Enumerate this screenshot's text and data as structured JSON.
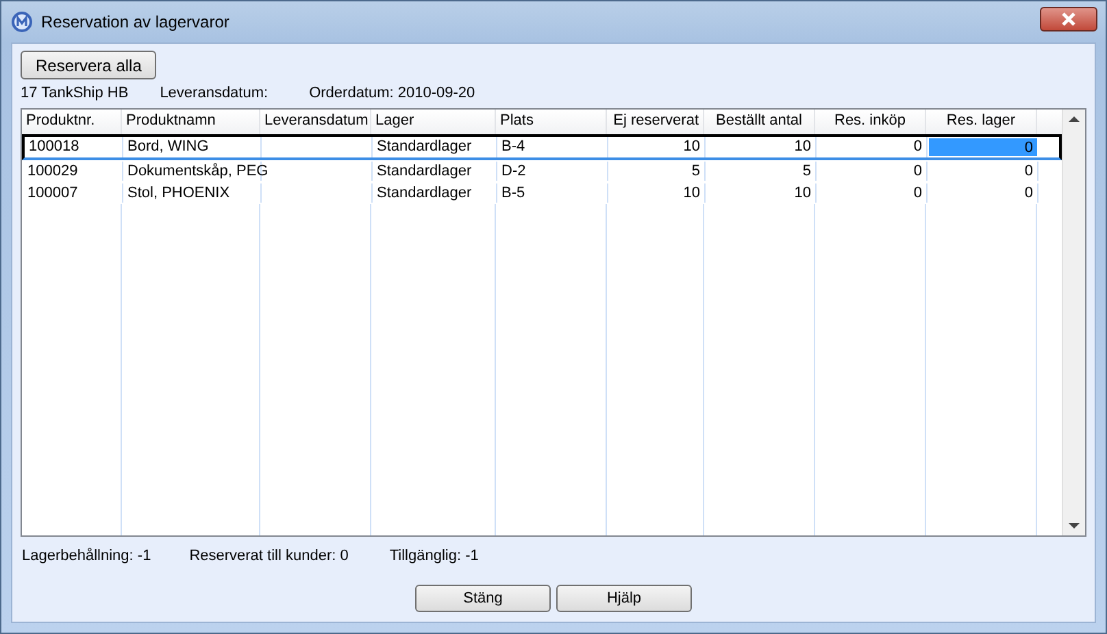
{
  "window": {
    "title": "Reservation av lagervaror"
  },
  "toolbar": {
    "reserve_all_button": "Reservera alla"
  },
  "order_info": [
    "17 TankShip HB",
    "Leveransdatum:",
    "Orderdatum: 2010-09-20"
  ],
  "table": {
    "columns": [
      {
        "label": "Produktnr.",
        "kind": "text",
        "editable": false
      },
      {
        "label": "Produktnamn",
        "kind": "text",
        "editable": false
      },
      {
        "label": "Leveransdatum",
        "kind": "text",
        "editable": false
      },
      {
        "label": "Lager",
        "kind": "text",
        "editable": false
      },
      {
        "label": "Plats",
        "kind": "text",
        "editable": false
      },
      {
        "label": "Ej reserverat",
        "kind": "number",
        "editable": false
      },
      {
        "label": "Beställt antal",
        "kind": "number",
        "editable": false
      },
      {
        "label": "Res. inköp",
        "kind": "number",
        "editable": false
      },
      {
        "label": "Res. lager",
        "kind": "number",
        "editable": true
      }
    ],
    "rows": [
      {
        "selected": true,
        "cells": [
          "100018",
          "Bord, WING",
          "",
          "Standardlager",
          "B-4",
          "10",
          "10",
          "0",
          "0"
        ]
      },
      {
        "selected": false,
        "cells": [
          "100029",
          "Dokumentskåp, PEG",
          "",
          "Standardlager",
          "D-2",
          "5",
          "5",
          "0",
          "0"
        ]
      },
      {
        "selected": false,
        "cells": [
          "100007",
          "Stol, PHOENIX",
          "",
          "Standardlager",
          "B-5",
          "10",
          "10",
          "0",
          "0"
        ]
      }
    ]
  },
  "summary": [
    "Lagerbehållning: -1",
    "Reserverat till kunder: 0",
    "Tillgänglig: -1"
  ],
  "buttons": [
    "Stäng",
    "Hjälp"
  ]
}
